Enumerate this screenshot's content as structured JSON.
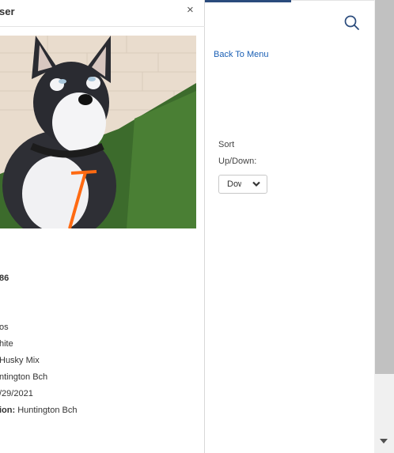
{
  "modal": {
    "title": "ser",
    "close_label": "×",
    "id_value": "86",
    "fields": [
      "os",
      "hite",
      "Husky Mix",
      "ntington Bch",
      "/29/2021"
    ],
    "location_label": "ion:",
    "location_value": "Huntington Bch"
  },
  "search": {
    "icon": "search-icon"
  },
  "nav": {
    "back_label": "Back To Menu"
  },
  "sort": {
    "label_line1": "Sort",
    "label_line2": "Up/Down:",
    "selected": "Down"
  },
  "colors": {
    "link": "#1a5fb4",
    "accent": "#2a4b7c",
    "scroll_thumb": "#c1c1c1"
  }
}
